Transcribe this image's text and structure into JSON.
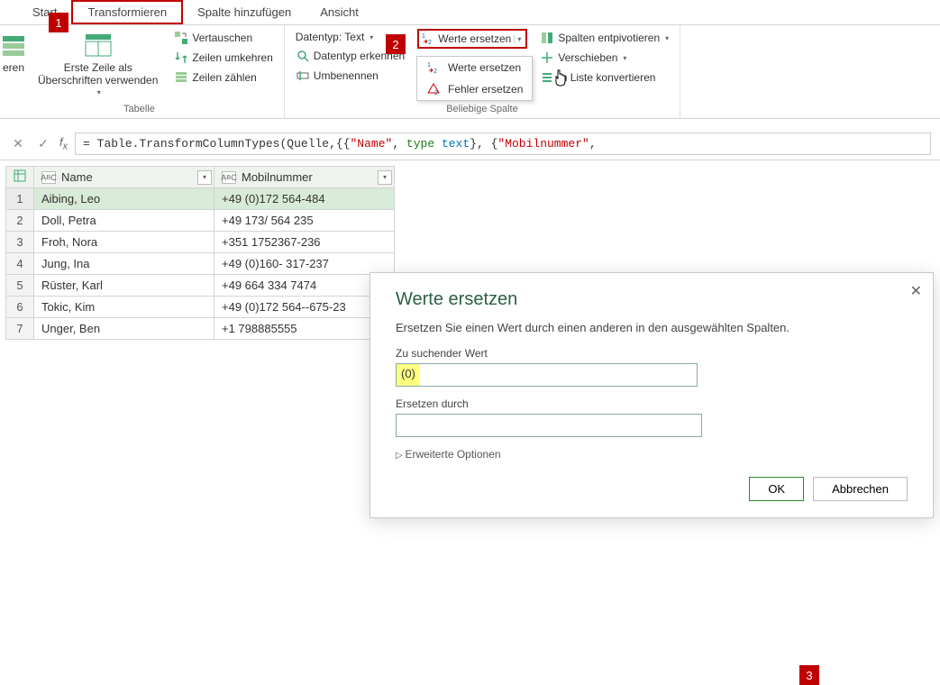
{
  "tabs": {
    "start": "Start",
    "transform": "Transformieren",
    "addcol": "Spalte hinzufügen",
    "view": "Ansicht"
  },
  "callouts": {
    "c1": "1",
    "c2": "2",
    "c3": "3"
  },
  "ribbon": {
    "group_table": {
      "label": "Tabelle",
      "first_row": "Erste Zeile als\nÜberschriften verwenden",
      "vertauschen": "Vertauschen",
      "zeilen_umkehren": "Zeilen umkehren",
      "zeilen_zaehlen": "Zeilen zählen"
    },
    "group_anycol": {
      "label": "Beliebige Spalte",
      "datentyp": "Datentyp: Text",
      "datentyp_erkennen": "Datentyp erkennen",
      "umbenennen": "Umbenennen",
      "werte_ersetzen": "Werte ersetzen",
      "entpivotieren": "Spalten entpivotieren",
      "verschieben": "Verschieben",
      "in_liste": "In Liste konvertieren"
    },
    "dropdown": {
      "werte": "Werte ersetzen",
      "fehler": "Fehler ersetzen"
    }
  },
  "formula": {
    "prefix": "= Table.TransformColumnTypes(Quelle,{{",
    "s1": "\"Name\"",
    "sep1": ", ",
    "kw_type1": "type",
    "sp1": " ",
    "t1": "text",
    "mid": "}, {",
    "s2": "\"Mobilnummer\"",
    "tail": ","
  },
  "table": {
    "col1": "Name",
    "col2": "Mobilnummer",
    "type_label": "ABC",
    "rows": [
      {
        "n": "1",
        "name": "Aibing, Leo",
        "mobil": " +49 (0)172 564-484"
      },
      {
        "n": "2",
        "name": "Doll, Petra",
        "mobil": "+49 173/ 564 235"
      },
      {
        "n": "3",
        "name": "Froh, Nora",
        "mobil": "+351 1752367-236"
      },
      {
        "n": "4",
        "name": "Jung, Ina",
        "mobil": "+49 (0)160- 317-237"
      },
      {
        "n": "5",
        "name": "Rüster, Karl",
        "mobil": " +49 664 334 7474"
      },
      {
        "n": "6",
        "name": "Tokic, Kim",
        "mobil": "+49 (0)172 564--675-23"
      },
      {
        "n": "7",
        "name": "Unger, Ben",
        "mobil": "+1 798885555"
      }
    ]
  },
  "dialog": {
    "title": "Werte ersetzen",
    "desc": "Ersetzen Sie einen Wert durch einen anderen in den ausgewählten Spalten.",
    "find_label": "Zu suchender Wert",
    "find_value": "(0)",
    "replace_label": "Ersetzen durch",
    "replace_value": "",
    "advanced": "Erweiterte Optionen",
    "ok": "OK",
    "cancel": "Abbrechen"
  }
}
